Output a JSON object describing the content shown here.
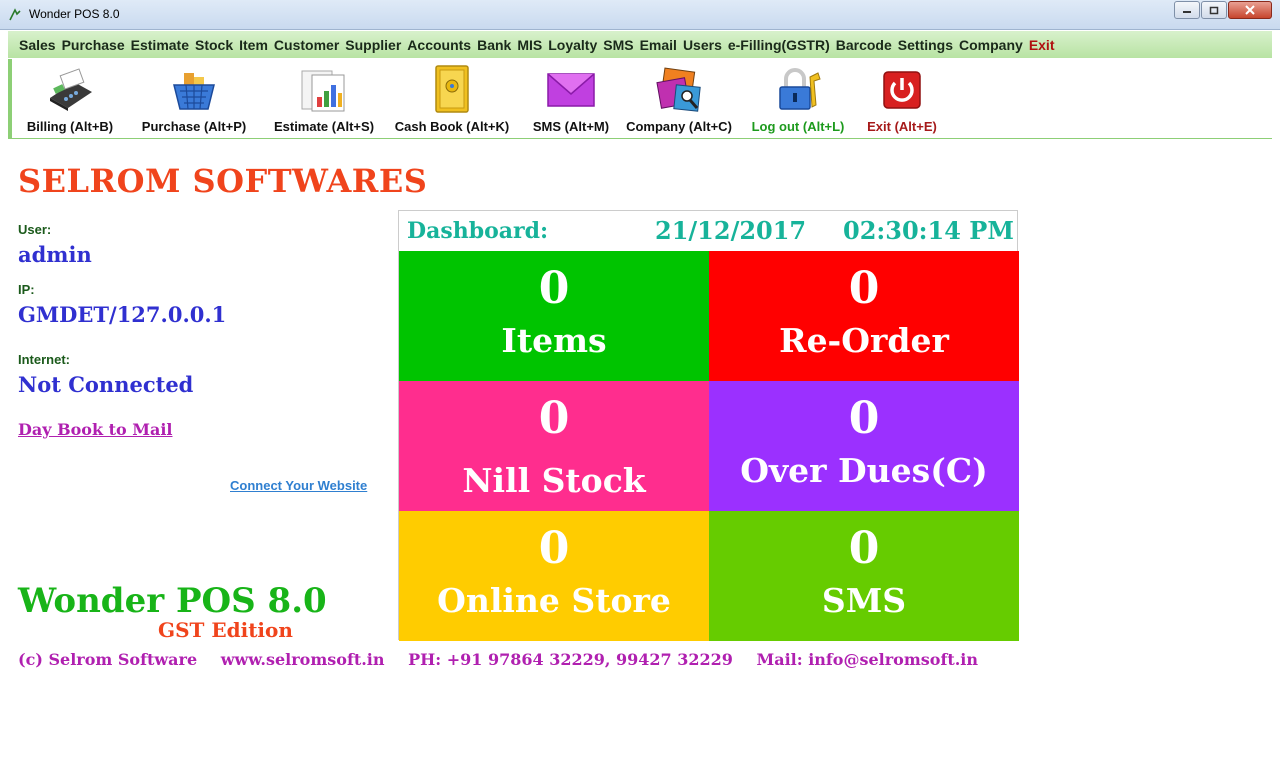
{
  "window": {
    "title": "Wonder POS 8.0"
  },
  "menu": [
    "Sales",
    "Purchase",
    "Estimate",
    "Stock",
    "Item",
    "Customer",
    "Supplier",
    "Accounts",
    "Bank",
    "MIS",
    "Loyalty",
    "SMS",
    "Email",
    "Users",
    "e-Filling(GSTR)",
    "Barcode",
    "Settings",
    "Company",
    "Exit"
  ],
  "toolbar": [
    {
      "label": "Billing (Alt+B)",
      "icon": "billing-machine-icon"
    },
    {
      "label": "Purchase (Alt+P)",
      "icon": "shopping-basket-icon"
    },
    {
      "label": "Estimate (Alt+S)",
      "icon": "chart-report-icon"
    },
    {
      "label": "Cash Book (Alt+K)",
      "icon": "safe-icon"
    },
    {
      "label": "SMS (Alt+M)",
      "icon": "envelope-icon"
    },
    {
      "label": "Company (Alt+C)",
      "icon": "company-pictures-icon"
    },
    {
      "label": "Log out (Alt+L)",
      "icon": "padlock-icon"
    },
    {
      "label": "Exit (Alt+E)",
      "icon": "power-icon"
    }
  ],
  "company_name": "SELROM SOFTWARES",
  "user": {
    "label": "User:",
    "value": "admin"
  },
  "ip": {
    "label": "IP:",
    "value": "GMDET/127.0.0.1"
  },
  "internet": {
    "label": "Internet:",
    "value": "Not Connected"
  },
  "links": {
    "day_book": "Day Book to Mail",
    "website": "Connect Your Website"
  },
  "product": {
    "name": "Wonder POS 8.0",
    "edition": "GST Edition"
  },
  "footer": {
    "copyright": "(c) Selrom Software",
    "web": "www.selromsoft.in",
    "phone": "PH: +91 97864 32229, 99427 32229",
    "mail": "Mail: info@selromsoft.in"
  },
  "dashboard": {
    "title": "Dashboard:",
    "date": "21/12/2017",
    "time": "02:30:14 PM",
    "tiles": [
      {
        "value": "0",
        "label": "Items",
        "color": "#00c400"
      },
      {
        "value": "0",
        "label": "Re-Order",
        "color": "#ff0000"
      },
      {
        "value": "0",
        "label": "Nill Stock",
        "color": "#ff2d8e"
      },
      {
        "value": "0",
        "label": "Over Dues(C)",
        "color": "#9b30ff"
      },
      {
        "value": "0",
        "label": "Online Store",
        "color": "#ffcc00"
      },
      {
        "value": "0",
        "label": "SMS",
        "color": "#66cc00"
      }
    ]
  },
  "colors": {
    "accent_green": "#8dcf76",
    "company_orange": "#f0441c",
    "value_blue": "#3030d0",
    "link_magenta": "#b020b0"
  }
}
